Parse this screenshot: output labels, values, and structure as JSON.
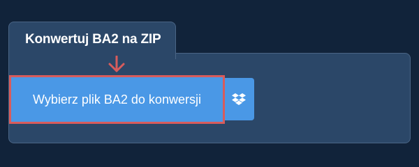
{
  "tab": {
    "title": "Konwertuj BA2 na ZIP"
  },
  "upload": {
    "button_label": "Wybierz plik BA2 do konwersji",
    "dropbox_icon": "dropbox-icon"
  },
  "annotation": {
    "arrow_icon": "arrow-down-icon",
    "highlight_color": "#d85c5c"
  },
  "colors": {
    "background": "#11233a",
    "panel": "#2b4768",
    "panel_border": "#4a6585",
    "button": "#4a98e6",
    "text": "#ffffff"
  }
}
